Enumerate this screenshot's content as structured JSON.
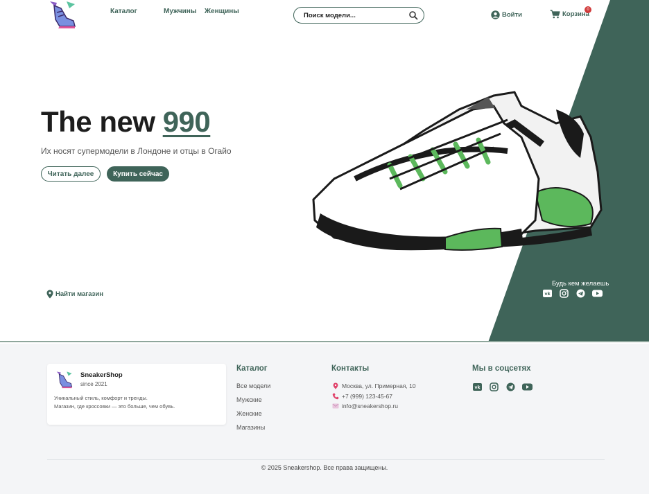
{
  "header": {
    "nav": [
      "Каталог",
      "Мужчины",
      "Женщины"
    ],
    "search_placeholder": "Поиск модели...",
    "login_label": "Войти",
    "cart_label": "Корзина",
    "cart_count": "0"
  },
  "hero": {
    "title_prefix": "The new ",
    "title_accent": "990",
    "subtitle": "Их носят супермодели в Лондоне и отцы в Огайо",
    "read_more": "Читать далее",
    "buy_now": "Купить сейчас",
    "find_store": "Найти магазин",
    "tagline": "Будь кем желаешь",
    "social_icons": [
      "vk-icon",
      "instagram-icon",
      "telegram-icon",
      "youtube-icon"
    ]
  },
  "footer": {
    "brand": "SneakerShop",
    "since": "since 2021",
    "desc_line1": "Уникальный стиль, комфорт и тренды.",
    "desc_line2": "Магазин, где кроссовки — это больше, чем обувь.",
    "catalog_title": "Каталог",
    "catalog_links": [
      "Все модели",
      "Мужские",
      "Женские",
      "Магазины"
    ],
    "contacts_title": "Контакты",
    "address": "Москва, ул. Примерная, 10",
    "phone": "+7 (999) 123-45-67",
    "email": "info@sneakershop.ru",
    "social_title": "Мы в соцсетях",
    "copyright": "© 2025 Sneakershop. Все права защищены."
  },
  "colors": {
    "accent": "#3f6459",
    "badge": "#d13b3b",
    "footer_bg": "#f4f5f7"
  }
}
